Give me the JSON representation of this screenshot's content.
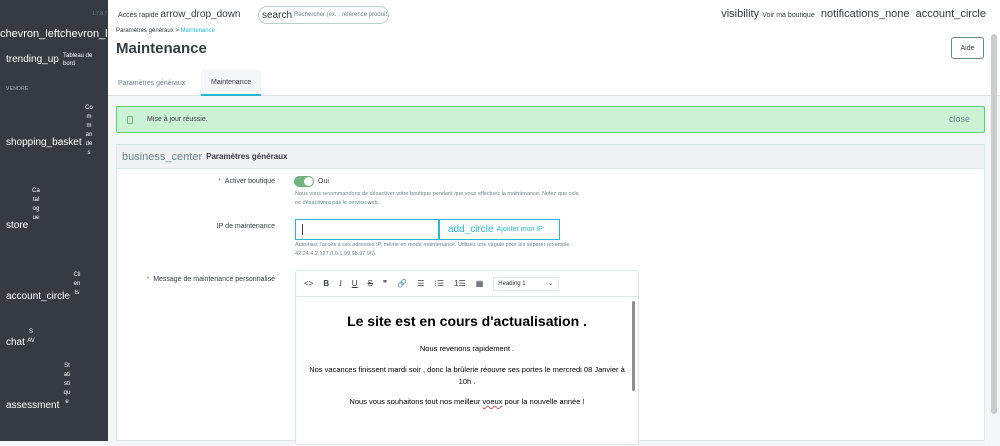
{
  "sidebar": {
    "collapse": "chevron_leftchevron_left",
    "dashboard_icon": "trending_up",
    "dashboard_label": "Tableau de bord",
    "section": "VENDRE",
    "items": [
      {
        "icon": "shopping_basket",
        "label": "Commandes"
      },
      {
        "icon": "store",
        "label": "Catalogue"
      },
      {
        "icon": "account_circle",
        "label": "Clients"
      },
      {
        "icon": "chat",
        "label": "SAV"
      },
      {
        "icon": "assessment",
        "label": "Statistique"
      }
    ]
  },
  "topbar": {
    "version": "1.7.8.7",
    "quick_access": "Accès rapide",
    "quick_icon": "arrow_drop_down",
    "search_icon": "search",
    "search_placeholder": "Rechercher (ex. : référence produit,",
    "view_icon": "visibility",
    "view_label": "Voir ma boutique",
    "notif_icon": "notifications_none",
    "account_icon": "account_circle"
  },
  "header": {
    "breadcrumb_parent": "Paramètres généraux",
    "breadcrumb_sep": ">",
    "breadcrumb_current": "Maintenance",
    "title": "Maintenance",
    "help": "Aide",
    "tabs": [
      {
        "label": "Paramètres généraux"
      },
      {
        "label": "Maintenance"
      }
    ]
  },
  "alert": {
    "message": "Mise à jour réussie.",
    "close": "close"
  },
  "card": {
    "icon": "business_center",
    "title": "Paramètres généraux",
    "enable_label": "Activer boutique",
    "required": "*",
    "toggle_value": "Oui",
    "enable_hint_1": "Nous vous recommandons de désactiver votre boutique pendant que vous effectuez la maintenance. Notez que cela",
    "enable_hint_2": "ne désactivera pas le service web.",
    "ip_label": "IP de maintenance",
    "ip_value": "",
    "ip_button_icon": "add_circle",
    "ip_button": "Ajouter mon IP",
    "ip_hint_1": "Autorisez l'accès à ces adresses IP, même en mode maintenance. Utilisez une virgule pour les séparer (exemple :",
    "ip_hint_2": "42.24.4.2,127.0.0.1,99.98.97.96).",
    "msg_label": "Message de maintenance personnalisé"
  },
  "editor": {
    "toolbar": [
      "<>",
      "B",
      "I",
      "U",
      "S",
      "❞",
      "🔗",
      "☰",
      "⁝☰",
      "1☰",
      "▦"
    ],
    "heading_select": "Heading 1",
    "heading": "Le site est en cours d'actualisation .",
    "p1": "Nous revenons rapidement .",
    "p2": "Nos vacances finissent mardi soir , donc la brûlerie réouvre ses portes le mercredi 08 Janvier à 10h .",
    "p3_a": "Nous vous souhaitons tout nos meilleur ",
    "p3_word": "voeux",
    "p3_b": " pour la nouvelle année !"
  }
}
